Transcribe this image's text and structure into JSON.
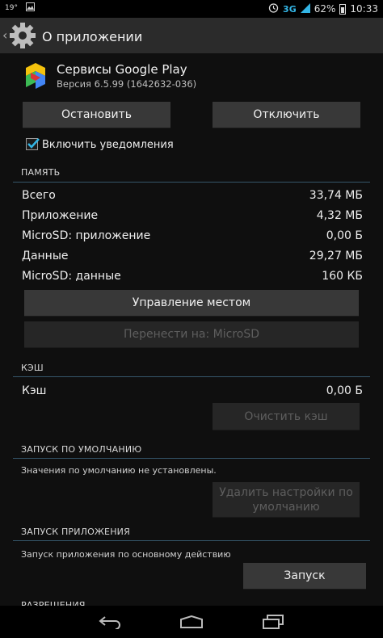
{
  "status_bar": {
    "temperature": "19°",
    "network": "3G",
    "battery": "62%",
    "time": "10:33"
  },
  "action_bar": {
    "title": "О приложении"
  },
  "app": {
    "name": "Сервисы Google Play",
    "version": "Версия 6.5.99 (1642632-036)"
  },
  "buttons": {
    "stop": "Остановить",
    "disable": "Отключить",
    "manage_space": "Управление местом",
    "move_to_sd": "Перенести на: MicroSD",
    "clear_cache": "Очистить кэш",
    "clear_defaults": "Удалить настройки по умолчанию",
    "launch": "Запуск"
  },
  "notifications": {
    "label": "Включить уведомления",
    "checked": true
  },
  "memory": {
    "header": "ПАМЯТЬ",
    "rows": [
      {
        "label": "Всего",
        "value": "33,74 МБ"
      },
      {
        "label": "Приложение",
        "value": "4,32 МБ"
      },
      {
        "label": "MicroSD: приложение",
        "value": "0,00 Б"
      },
      {
        "label": "Данные",
        "value": "29,27 МБ"
      },
      {
        "label": "MicroSD: данные",
        "value": "160 КБ"
      }
    ]
  },
  "cache": {
    "header": "КЭШ",
    "label": "Кэш",
    "value": "0,00 Б"
  },
  "defaults": {
    "header": "ЗАПУСК ПО УМОЛЧАНИЮ",
    "note": "Значения по умолчанию не установлены."
  },
  "launch": {
    "header": "ЗАПУСК ПРИЛОЖЕНИЯ",
    "note": "Запуск приложения по основному действию"
  },
  "permissions": {
    "header": "РАЗРЕШЕНИЯ"
  },
  "colors": {
    "accent": "#33b5e5",
    "divider": "#35566a",
    "button": "#383838"
  }
}
